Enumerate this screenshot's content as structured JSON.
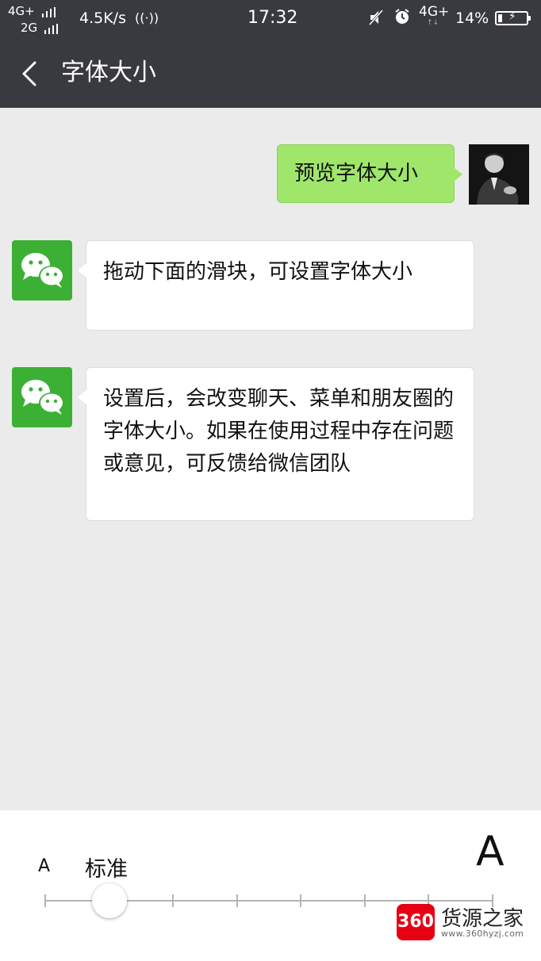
{
  "status_bar": {
    "signal_top": "4G+",
    "signal_bottom": "2G",
    "net_speed": "4.5K/s",
    "speed_icon": "((·))",
    "time": "17:32",
    "network": "4G+",
    "battery": "14%"
  },
  "header": {
    "title": "字体大小"
  },
  "chat": {
    "messages": [
      {
        "side": "right",
        "text": "预览字体大小"
      },
      {
        "side": "left",
        "text": "拖动下面的滑块，可设置字体大小"
      },
      {
        "side": "left",
        "text": "设置后，会改变聊天、菜单和朋友圈的字体大小。如果在使用过程中存在问题或意见，可反馈给微信团队"
      }
    ]
  },
  "font_panel": {
    "small_label": "A",
    "current_label": "标准",
    "large_label": "A",
    "level_count": 8,
    "selected_level": 2
  },
  "watermark": {
    "badge": "360",
    "name": "货源之家",
    "url": "www.360hyzj.com"
  },
  "colors": {
    "header_bg": "#393a3f",
    "chat_bg": "#ebebeb",
    "sent_bubble": "#9fe66b",
    "wechat_green": "#3cb034"
  }
}
